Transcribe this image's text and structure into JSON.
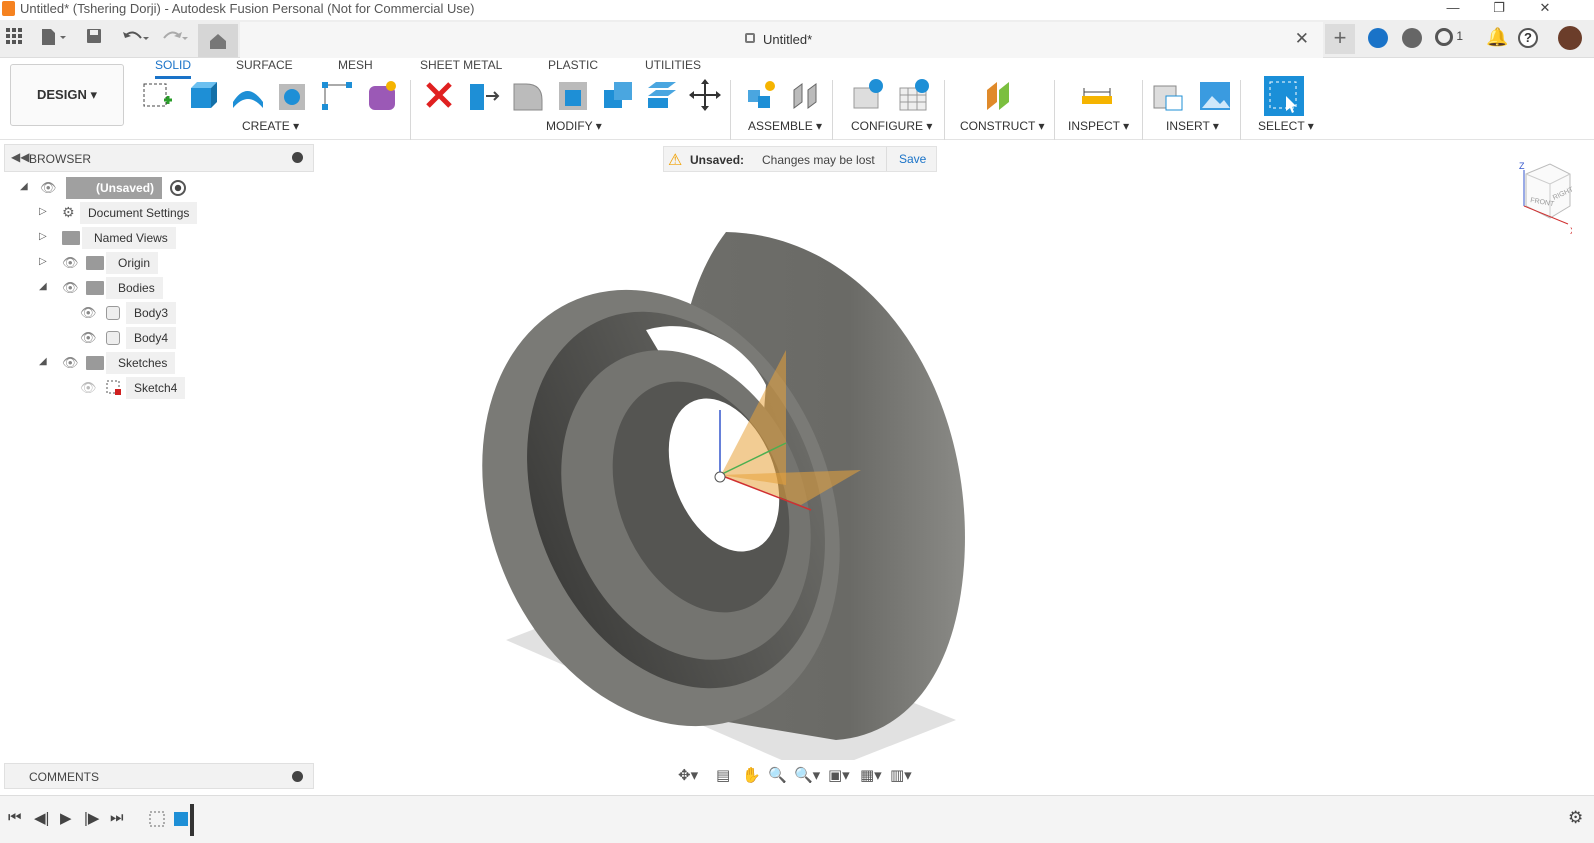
{
  "window": {
    "title": "Untitled* (Tshering Dorji) - Autodesk Fusion Personal (Not for Commercial Use)",
    "minimize": "—",
    "restore": "❐",
    "close": "✕"
  },
  "document": {
    "tab_name": "Untitled*",
    "close": "✕",
    "new_tab": "+"
  },
  "jobs": {
    "count": "1"
  },
  "workspace": {
    "label": "DESIGN ▾"
  },
  "tabs": [
    {
      "label": "SOLID",
      "active": true
    },
    {
      "label": "SURFACE",
      "active": false
    },
    {
      "label": "MESH",
      "active": false
    },
    {
      "label": "SHEET METAL",
      "active": false
    },
    {
      "label": "PLASTIC",
      "active": false
    },
    {
      "label": "UTILITIES",
      "active": false
    }
  ],
  "groups": {
    "create": "CREATE ▾",
    "modify": "MODIFY ▾",
    "assemble": "ASSEMBLE ▾",
    "configure": "CONFIGURE ▾",
    "construct": "CONSTRUCT ▾",
    "inspect": "INSPECT ▾",
    "insert": "INSERT ▾",
    "select": "SELECT ▾"
  },
  "browser": {
    "title": "BROWSER",
    "root": "(Unsaved)",
    "items": [
      {
        "label": "Document Settings"
      },
      {
        "label": "Named Views"
      },
      {
        "label": "Origin"
      },
      {
        "label": "Bodies"
      },
      {
        "label": "Body3"
      },
      {
        "label": "Body4"
      },
      {
        "label": "Sketches"
      },
      {
        "label": "Sketch4"
      }
    ]
  },
  "banner": {
    "status": "Unsaved:",
    "message": "Changes may be lost",
    "save": "Save"
  },
  "viewcube": {
    "front": "FRONT",
    "right": "RIGHT",
    "z": "Z",
    "x": "X"
  },
  "comments": {
    "title": "COMMENTS"
  },
  "colors": {
    "accent": "#1a73c8",
    "body_gray": "#6f6f6b",
    "app_orange": "#f58220",
    "warning": "#f0a000"
  }
}
